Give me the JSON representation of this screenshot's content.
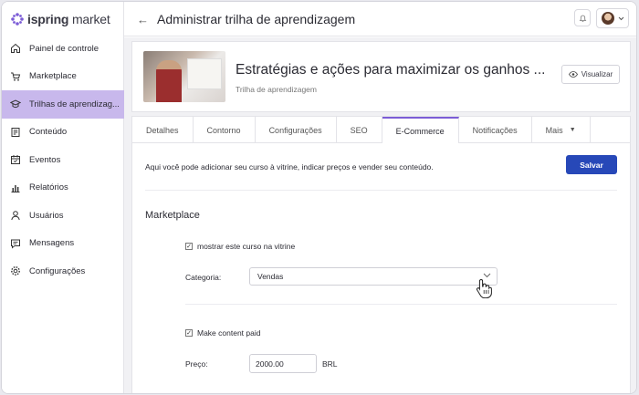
{
  "brand": {
    "logo_bold": "ispring",
    "logo_rest": " market",
    "accent": "#7b5cd6"
  },
  "sidebar": {
    "items": [
      {
        "label": "Painel de controle",
        "icon": "home-icon"
      },
      {
        "label": "Marketplace",
        "icon": "cart-icon"
      },
      {
        "label": "Trilhas de aprendizag...",
        "icon": "graduation-cap-icon",
        "active": true
      },
      {
        "label": "Conteúdo",
        "icon": "content-icon"
      },
      {
        "label": "Eventos",
        "icon": "calendar-icon"
      },
      {
        "label": "Relatórios",
        "icon": "bar-chart-icon"
      },
      {
        "label": "Usuários",
        "icon": "user-icon"
      },
      {
        "label": "Mensagens",
        "icon": "message-icon"
      },
      {
        "label": "Configurações",
        "icon": "gear-icon"
      }
    ]
  },
  "header": {
    "title": "Administrar trilha de aprendizagem"
  },
  "course": {
    "title": "Estratégias e ações para maximizar os ganhos ...",
    "subtitle": "Trilha de aprendizagem",
    "view_label": "Visualizar"
  },
  "tabs": [
    {
      "label": "Detalhes"
    },
    {
      "label": "Contorno"
    },
    {
      "label": "Configurações"
    },
    {
      "label": "SEO"
    },
    {
      "label": "E-Commerce",
      "active": true
    },
    {
      "label": "Notificações"
    },
    {
      "label": "Mais",
      "dropdown": true
    }
  ],
  "ecommerce": {
    "intro": "Aqui você pode adicionar seu curso à vitrine, indicar preços e vender seu conteúdo.",
    "save_label": "Salvar",
    "section_title": "Marketplace",
    "show_in_store_label": "mostrar este curso na vitrine",
    "show_in_store_checked": true,
    "category_label": "Categoria:",
    "category_value": "Vendas",
    "paid_label": "Make content paid",
    "paid_checked": true,
    "price_label": "Preço:",
    "price_value": "2000.00",
    "currency": "BRL"
  }
}
